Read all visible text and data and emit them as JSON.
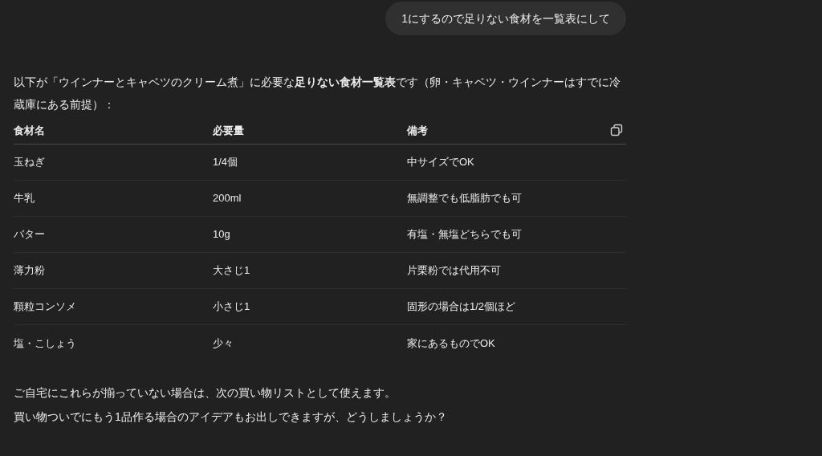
{
  "user_message": "1にするので足りない食材を一覧表にして",
  "intro": "以下が「ウインナーとキャベツのクリーム煮」に必要な**足りない食材一覧表**です（卵・キャベツ・ウインナーはすでに冷蔵庫にある前提）：",
  "table": {
    "columns": [
      "食材名",
      "必要量",
      "備考"
    ],
    "rows": [
      [
        "玉ねぎ",
        "1/4個",
        "中サイズでOK"
      ],
      [
        "牛乳",
        "200ml",
        "無調整でも低脂肪でも可"
      ],
      [
        "バター",
        "10g",
        "有塩・無塩どちらでも可"
      ],
      [
        "薄力粉",
        "大さじ1",
        "片栗粉では代用不可"
      ],
      [
        "顆粒コンソメ",
        "小さじ1",
        "固形の場合は1/2個ほど"
      ],
      [
        "塩・こしょう",
        "少々",
        "家にあるものでOK"
      ]
    ]
  },
  "closing": [
    "ご自宅にこれらが揃っていない場合は、次の買い物リストとして使えます。",
    "買い物ついでにもう1品作る場合のアイデアもお出しできますが、どうしましょうか？"
  ]
}
